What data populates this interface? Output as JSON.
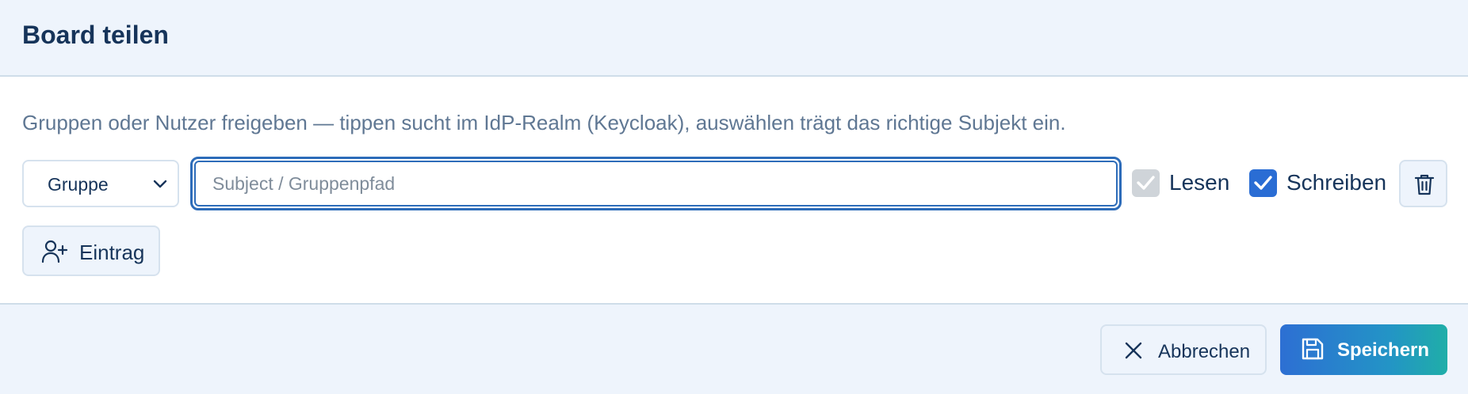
{
  "dialog": {
    "title": "Board teilen"
  },
  "body": {
    "description": "Gruppen oder Nutzer freigeben — tippen sucht im IdP-Realm (Keycloak), auswählen trägt das richtige Subjekt ein.",
    "entry": {
      "type_selected": "Gruppe",
      "subject_placeholder": "Subject / Gruppenpfad",
      "subject_value": "",
      "read_label": "Lesen",
      "read_checked": true,
      "read_disabled": true,
      "write_label": "Schreiben",
      "write_checked": true,
      "delete_icon": "trash-icon"
    },
    "add_entry_label": "Eintrag",
    "add_entry_icon": "user-plus-icon"
  },
  "footer": {
    "cancel_label": "Abbrechen",
    "cancel_icon": "close-icon",
    "save_label": "Speichern",
    "save_icon": "save-icon"
  },
  "colors": {
    "accent": "#2a6dd4",
    "title_text": "#16345a",
    "muted_text": "#5f7793",
    "header_bg": "#eef4fc",
    "save_gradient_start": "#2d6fd3",
    "save_gradient_end": "#20aea8"
  }
}
